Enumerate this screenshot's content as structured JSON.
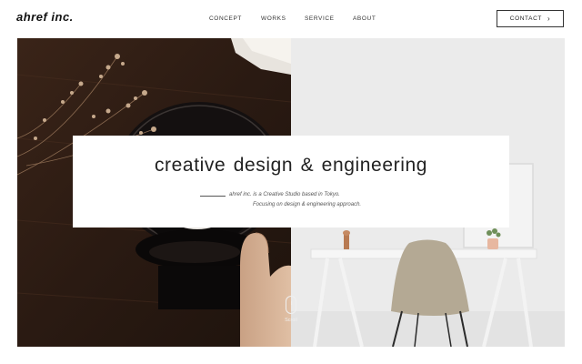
{
  "header": {
    "logo": "ahref inc.",
    "nav": [
      "CONCEPT",
      "WORKS",
      "SERVICE",
      "ABOUT"
    ],
    "contact_label": "CONTACT",
    "contact_icon": "chevron-right-icon"
  },
  "hero": {
    "headline": "creative design &  engineering",
    "tagline_1": "ahref inc. is a Creative Studio based in Tokyo.",
    "tagline_2": "Focusing on design & engineering approach.",
    "scroll_label": "Scroll"
  }
}
